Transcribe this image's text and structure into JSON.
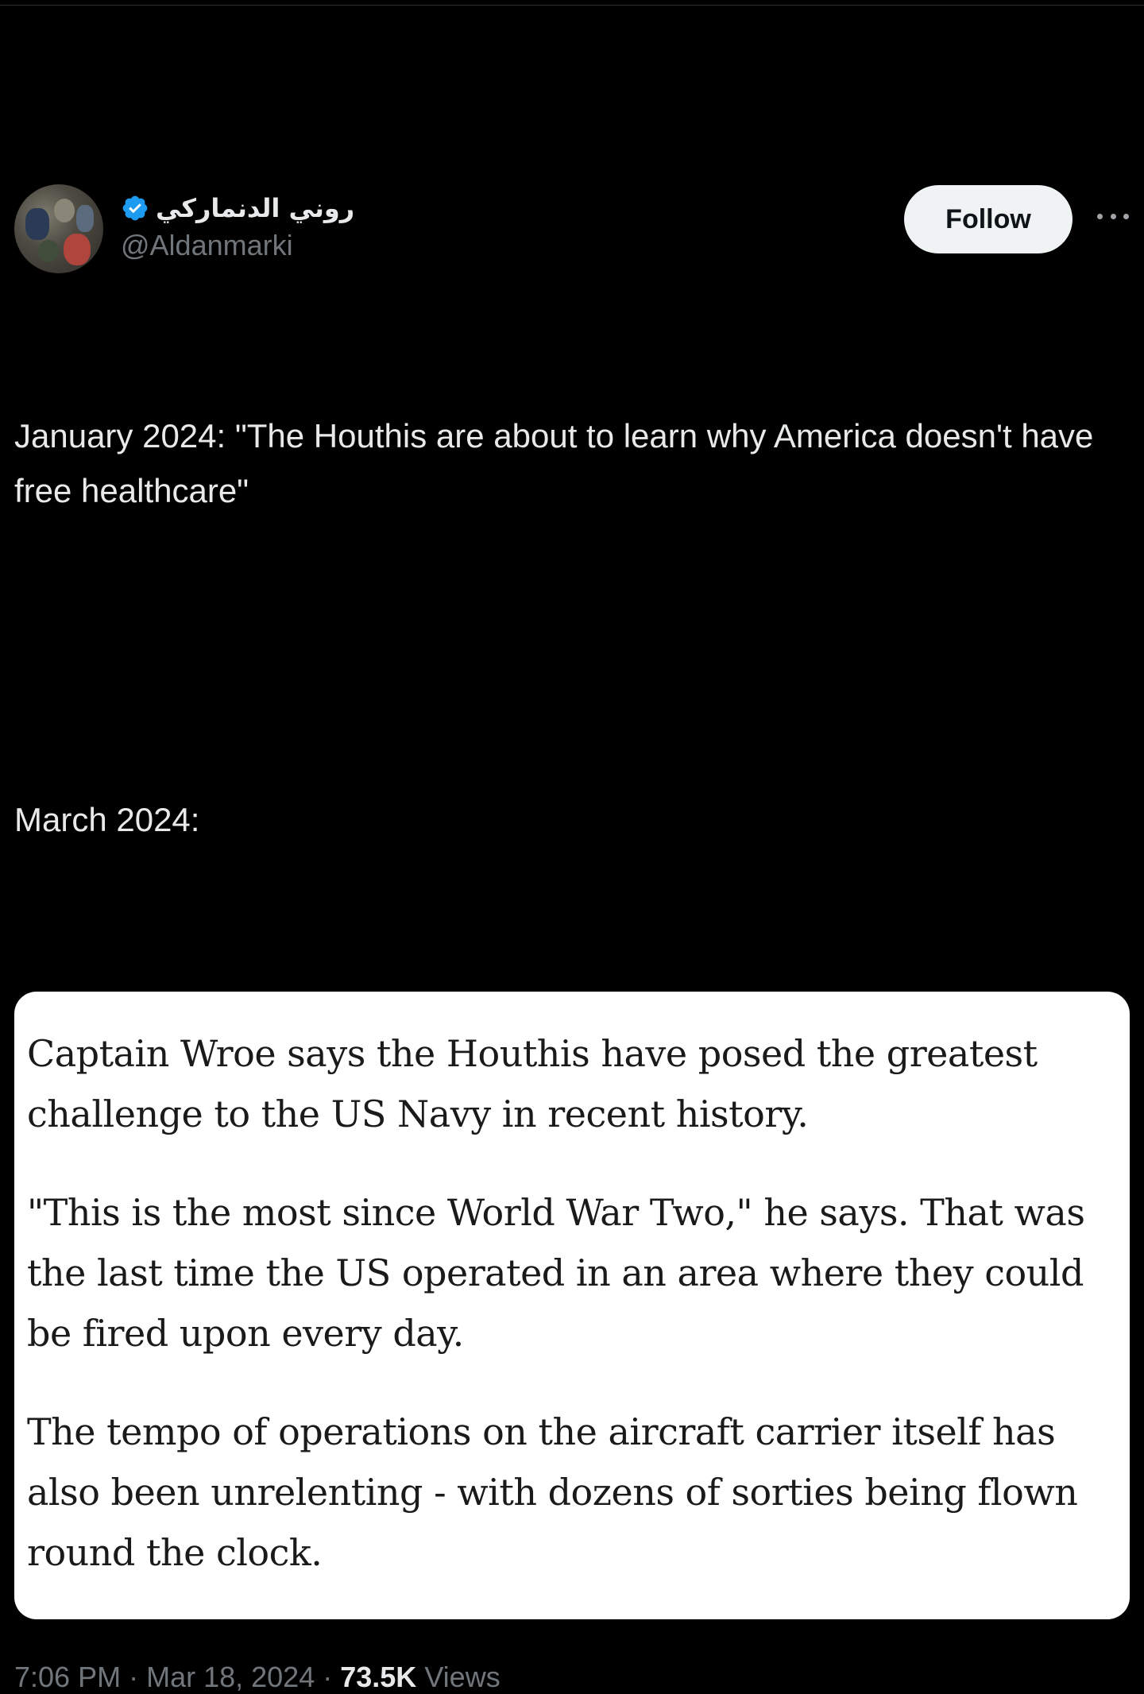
{
  "tweet": {
    "author": {
      "display_name": "روني الدنماركي",
      "handle": "@Aldanmarki",
      "verified_icon": "verified-badge-icon",
      "verified_color": "#1d9bf0"
    },
    "follow_label": "Follow",
    "more_icon": "more-options-icon",
    "body": {
      "line1": "January 2024: \"The Houthis are about to learn why America doesn't have free healthcare\"",
      "line2": "March 2024:"
    },
    "quote_card": {
      "paragraphs": [
        "Captain Wroe says the Houthis have posed the greatest challenge to the US Navy in recent history.",
        "\"This is the most since World War Two,\" he says. That was the last time the US operated in an area where they could be fired upon every day.",
        "The tempo of operations on the aircraft carrier itself has also been unrelenting - with dozens of sorties being flown round the clock."
      ]
    },
    "meta": {
      "time": "7:06 PM",
      "separator": "·",
      "date": "Mar 18, 2024",
      "views_count": "73.5K",
      "views_label": "Views"
    }
  }
}
